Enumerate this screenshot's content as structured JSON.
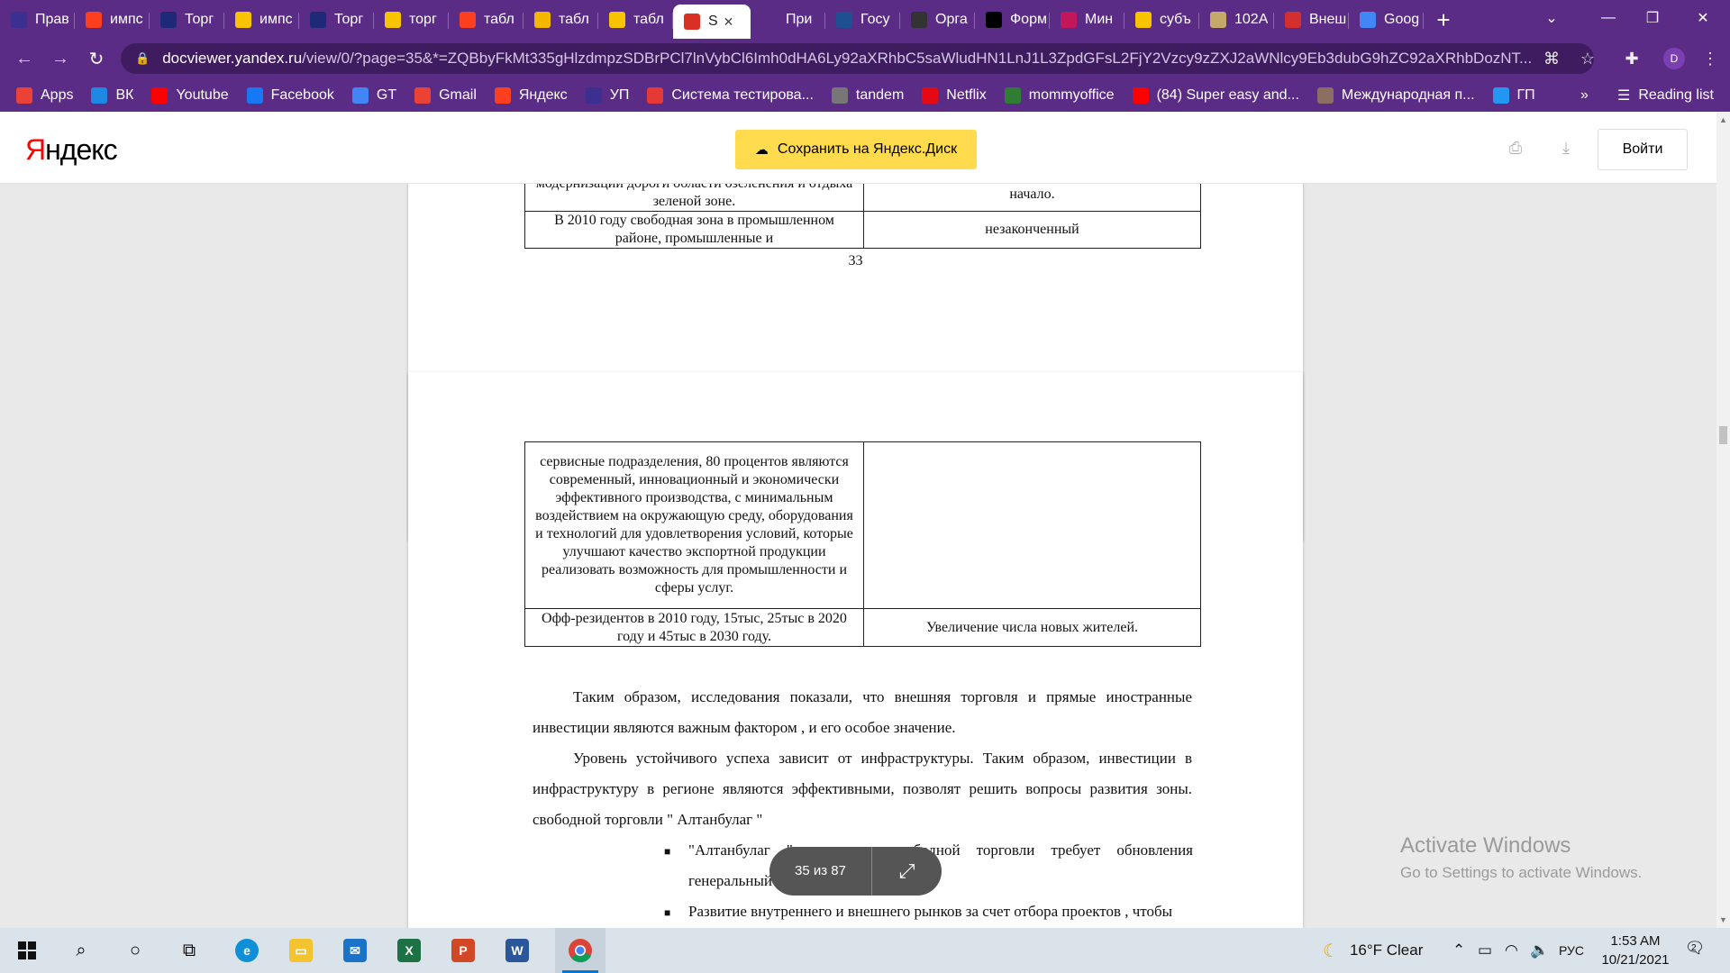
{
  "browser": {
    "tabs": [
      {
        "title": "Прав",
        "icon": "compass-icon",
        "color": "#3b2f8f"
      },
      {
        "title": "импс",
        "icon": "yandex-icon",
        "color": "#fc3f1d"
      },
      {
        "title": "Торг",
        "icon": "t-icon",
        "color": "#1e2a78"
      },
      {
        "title": "импс",
        "icon": "yandex-disk-icon",
        "color": "#f8c400"
      },
      {
        "title": "Торг",
        "icon": "t-icon",
        "color": "#1e2a78"
      },
      {
        "title": "торг",
        "icon": "yandex-disk-icon",
        "color": "#f8c400"
      },
      {
        "title": "табл",
        "icon": "yandex-icon",
        "color": "#fc3f1d"
      },
      {
        "title": "табл",
        "icon": "play-icon",
        "color": "#f3b700"
      },
      {
        "title": "табл",
        "icon": "yandex-disk-icon",
        "color": "#f8c400"
      },
      {
        "title": "S",
        "icon": "pdf-icon",
        "color": "#d93025",
        "active": true
      },
      {
        "title": "При",
        "icon": "globe-icon",
        "color": "#5b2c86"
      },
      {
        "title": "Госу",
        "icon": "gosuslugi-icon",
        "color": "#1d4f91"
      },
      {
        "title": "Орга",
        "icon": "chart-icon",
        "color": "#333333"
      },
      {
        "title": "Форм",
        "icon": "a-icon",
        "color": "#000000"
      },
      {
        "title": "Мин",
        "icon": "ministry-icon",
        "color": "#c2185b"
      },
      {
        "title": "субъ",
        "icon": "yandex-disk-icon",
        "color": "#f8c400"
      },
      {
        "title": "102А",
        "icon": "doc-icon",
        "color": "#c5a96a"
      },
      {
        "title": "Внеш",
        "icon": "book-icon",
        "color": "#d32f2f"
      },
      {
        "title": "Goog",
        "icon": "translate-icon",
        "color": "#4285f4"
      }
    ],
    "url_domain": "docviewer.yandex.ru",
    "url_path": "/view/0/?page=35&*=ZQBbyFkMt335gHlzdmpzSDBrPCl7lnVybCl6Imh0dHA6Ly92aXRhbC5saWludHN1LnJ1L3ZpdGFsL2FjY2Vzcy9zZXJ2aWNlcy9Eb3dubG9hZC92aXRhbDozNT...",
    "profile_initial": "D",
    "bookmarks": [
      {
        "label": "Apps",
        "icon": "apps-grid-icon",
        "color": "#ea4335"
      },
      {
        "label": "ВК",
        "icon": "vk-icon",
        "color": "#1e88e5"
      },
      {
        "label": "Youtube",
        "icon": "youtube-icon",
        "color": "#ff0000"
      },
      {
        "label": "Facebook",
        "icon": "facebook-icon",
        "color": "#1877f2"
      },
      {
        "label": "GT",
        "icon": "translate-icon",
        "color": "#4285f4"
      },
      {
        "label": "Gmail",
        "icon": "gmail-icon",
        "color": "#ea4335"
      },
      {
        "label": "Яндекс",
        "icon": "yandex-icon",
        "color": "#fc3f1d"
      },
      {
        "label": "УП",
        "icon": "compass-icon",
        "color": "#3b2f8f"
      },
      {
        "label": "Система тестирова...",
        "icon": "info-icon",
        "color": "#e53935"
      },
      {
        "label": "tandem",
        "icon": "globe-icon",
        "color": "#777777"
      },
      {
        "label": "Netflix",
        "icon": "netflix-icon",
        "color": "#e50914"
      },
      {
        "label": "mommyoffice",
        "icon": "office-icon",
        "color": "#2e7d32"
      },
      {
        "label": "(84) Super easy and...",
        "icon": "youtube-icon",
        "color": "#ff0000"
      },
      {
        "label": "Международная п...",
        "icon": "doc-icon",
        "color": "#8d6e63"
      },
      {
        "label": "ГП",
        "icon": "at-icon",
        "color": "#2196f3"
      }
    ],
    "reading_list": "Reading list",
    "more_bookmarks": "»"
  },
  "viewer": {
    "logo_first": "Я",
    "logo_rest": "ндекс",
    "save_label": "Сохранить на Яндекс.Диск",
    "login_label": "Войти",
    "page_indicator": "35 из 87"
  },
  "page1": {
    "rows": [
      {
        "left": "модернизации дороги области озеленения и отдыха зеленой зоне.",
        "right": "начало."
      },
      {
        "left": "В 2010 году свободная зона в промышленном районе, промышленные и",
        "right": "незаконченный"
      }
    ],
    "page_number": "33"
  },
  "page2": {
    "rows": [
      {
        "left": "сервисные подразделения, 80 процентов являются современный, инновационный и экономически эффективного производства, с минимальным воздействием на окружающую среду, оборудования и технологий для удовлетворения условий, которые улучшают качество экспортной продукции реализовать возможность для промышленности и сферы услуг.",
        "right": ""
      },
      {
        "left": "Офф-резидентов в 2010 году, 15тыс, 25тыс в 2020 году и 45тыс в 2030 году.",
        "right": "Увеличение числа новых жителей."
      }
    ],
    "para1": "Таким образом, исследования показали, что внешняя торговля и прямые иностранные инвестиции являются важным фактором , и его особое значение.",
    "para2": "Уровень устойчивого успеха   зависит от инфраструктуры. Таким образом, инвестиции в инфраструктуру в регионе являются эффективными, позволят решить вопросы развития  зоны. свободной торговли  \" Алтанбулаг \"",
    "bullet1": "\"Алтанбулаг  \"  как  зона  свободной  торговли  требует  обновления генеральный план",
    "bullet2": "Развитие  внутреннего и внешнего рынков за счет отбора проектов ,  чтобы"
  },
  "watermark": {
    "line1": "Activate Windows",
    "line2": "Go to Settings to activate Windows."
  },
  "taskbar": {
    "weather": "16°F  Clear",
    "language": "РУС",
    "time": "1:53 AM",
    "date": "10/21/2021",
    "notifications": "2"
  }
}
